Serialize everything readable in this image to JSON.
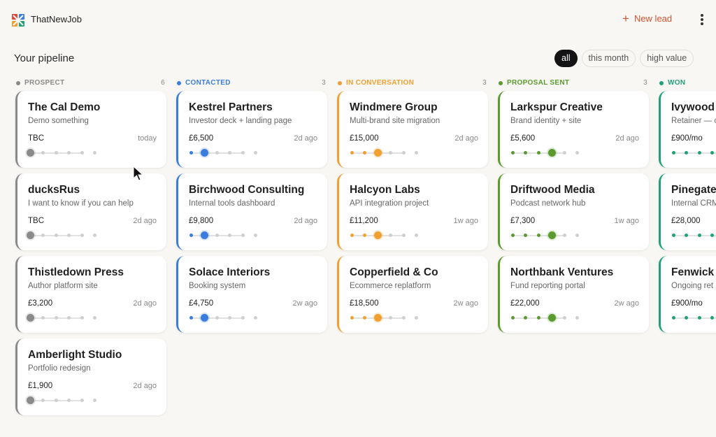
{
  "app": {
    "name": "ThatNewJob"
  },
  "header": {
    "new_lead_label": "New lead",
    "plus_icon": "+"
  },
  "page": {
    "title": "Your pipeline"
  },
  "filters": [
    {
      "label": "all",
      "active": true
    },
    {
      "label": "this month",
      "active": false
    },
    {
      "label": "high value",
      "active": false
    }
  ],
  "colors": {
    "accent": "#d0532f",
    "prospect": "#8a8a8a",
    "contacted": "#3b7ddd",
    "in_conversation": "#f0a030",
    "proposal_sent": "#5a9a2e",
    "won": "#20a07a"
  },
  "columns": [
    {
      "name": "PROSPECT",
      "count": "6",
      "color": "#8a8a8a",
      "stage": 1,
      "cards": [
        {
          "name": "The Cal Demo",
          "desc": "Demo something",
          "value": "TBC",
          "time": "today"
        },
        {
          "name": "ducksRus",
          "desc": "I want to know if you can help",
          "value": "TBC",
          "time": "2d ago"
        },
        {
          "name": "Thistledown Press",
          "desc": "Author platform site",
          "value": "£3,200",
          "time": "2d ago"
        },
        {
          "name": "Amberlight Studio",
          "desc": "Portfolio redesign",
          "value": "£1,900",
          "time": "2d ago"
        }
      ]
    },
    {
      "name": "CONTACTED",
      "count": "3",
      "color": "#3b7ddd",
      "stage": 2,
      "cards": [
        {
          "name": "Kestrel Partners",
          "desc": "Investor deck + landing page",
          "value": "£6,500",
          "time": "2d ago"
        },
        {
          "name": "Birchwood Consulting",
          "desc": "Internal tools dashboard",
          "value": "£9,800",
          "time": "2d ago"
        },
        {
          "name": "Solace Interiors",
          "desc": "Booking system",
          "value": "£4,750",
          "time": "2w ago"
        }
      ]
    },
    {
      "name": "IN CONVERSATION",
      "count": "3",
      "color": "#f0a030",
      "stage": 3,
      "cards": [
        {
          "name": "Windmere Group",
          "desc": "Multi-brand site migration",
          "value": "£15,000",
          "time": "2d ago"
        },
        {
          "name": "Halcyon Labs",
          "desc": "API integration project",
          "value": "£11,200",
          "time": "1w ago"
        },
        {
          "name": "Copperfield & Co",
          "desc": "Ecommerce replatform",
          "value": "£18,500",
          "time": "2w ago"
        }
      ]
    },
    {
      "name": "PROPOSAL SENT",
      "count": "3",
      "color": "#5a9a2e",
      "stage": 4,
      "cards": [
        {
          "name": "Larkspur Creative",
          "desc": "Brand identity + site",
          "value": "£5,600",
          "time": "2d ago"
        },
        {
          "name": "Driftwood Media",
          "desc": "Podcast network hub",
          "value": "£7,300",
          "time": "1w ago"
        },
        {
          "name": "Northbank Ventures",
          "desc": "Fund reporting portal",
          "value": "£22,000",
          "time": "2w ago"
        }
      ]
    },
    {
      "name": "WON",
      "count": "",
      "color": "#20a07a",
      "stage": 6,
      "cards": [
        {
          "name": "Ivywood",
          "desc": "Retainer — c",
          "value": "£900/mo",
          "time": ""
        },
        {
          "name": "Pinegate",
          "desc": "Internal CRM",
          "value": "£28,000",
          "time": ""
        },
        {
          "name": "Fenwick",
          "desc": "Ongoing ret",
          "value": "£900/mo",
          "time": ""
        }
      ]
    }
  ]
}
